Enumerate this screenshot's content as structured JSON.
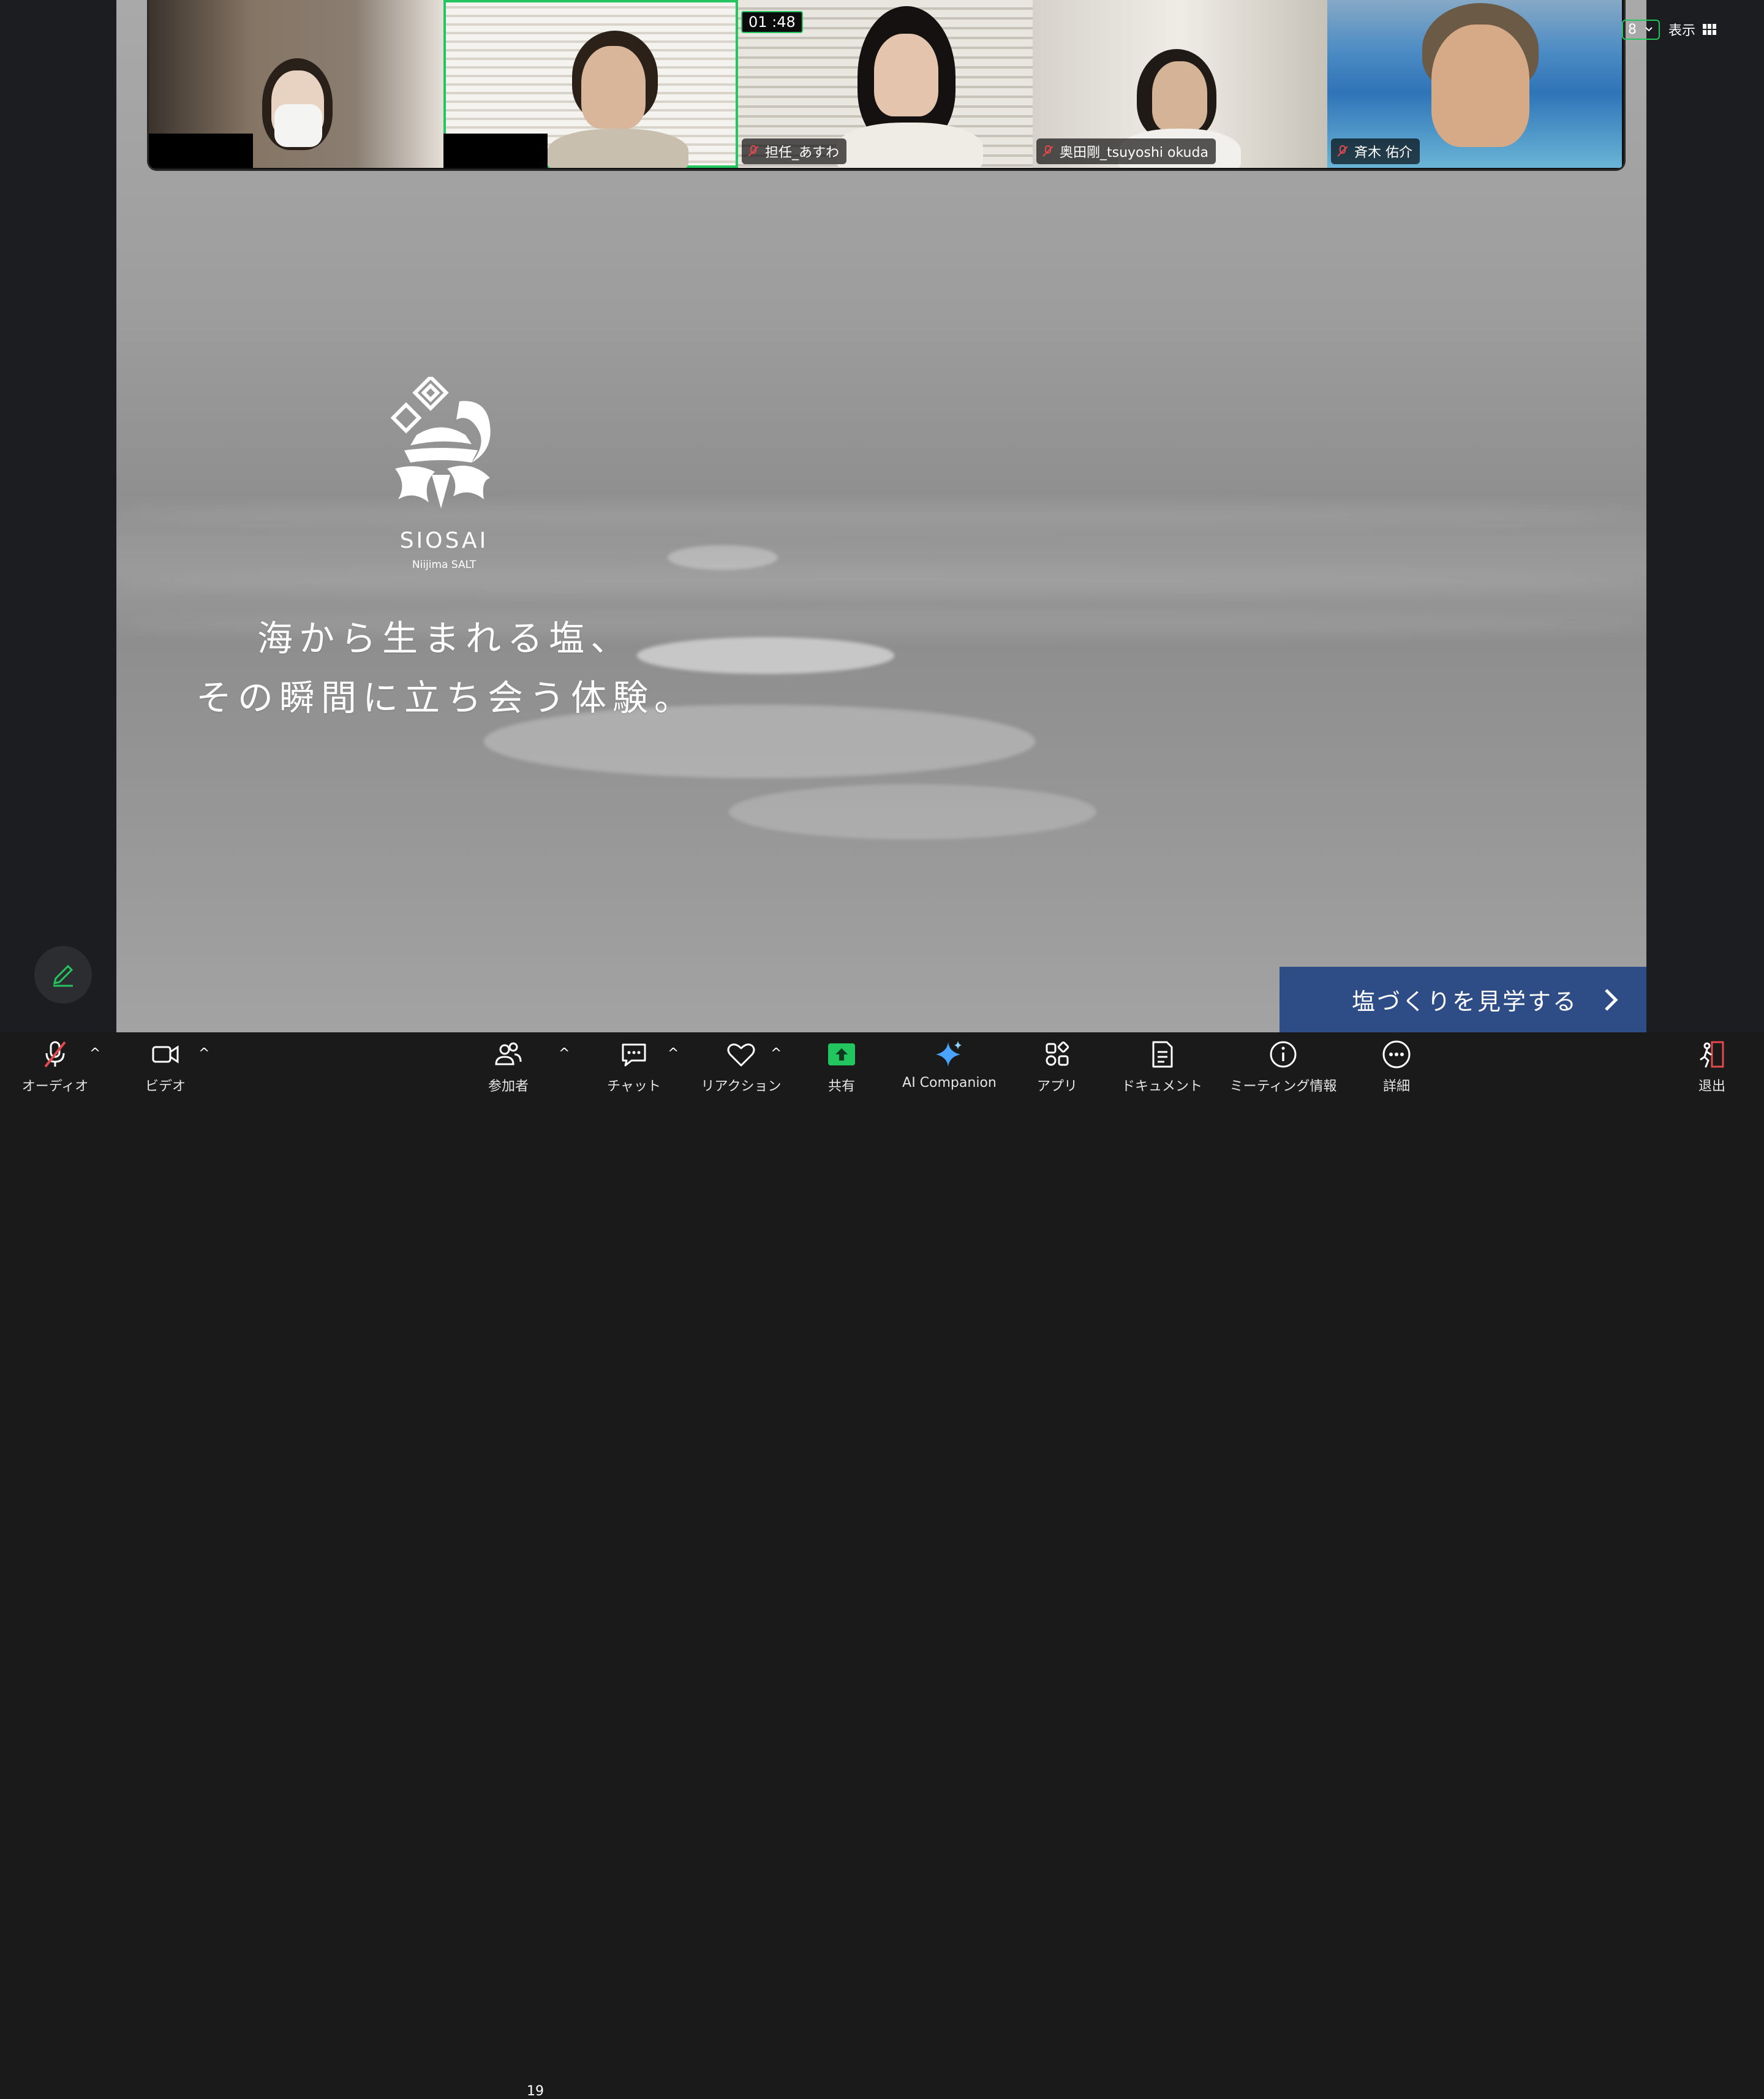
{
  "gallery": {
    "participants": [
      {
        "name": "",
        "muted": false
      },
      {
        "name": "",
        "muted": false,
        "active_speaker": true
      },
      {
        "name": "担任_あすわ",
        "muted": true
      },
      {
        "name": "奥田剛_tsuyoshi okuda",
        "muted": true
      },
      {
        "name": "斉木 佑介",
        "muted": true
      }
    ],
    "timer": "01 :48"
  },
  "view_controls": {
    "count": "8",
    "view_label": "表示"
  },
  "shared_screen": {
    "brand": "SIOSAI",
    "brand_sub": "Niijima SALT",
    "headline_line1": "海から生まれる塩、",
    "headline_line2": "その瞬間に立ち会う体験。",
    "tour_button": "塩づくりを見学する"
  },
  "toolbar": {
    "audio": "オーディオ",
    "video": "ビデオ",
    "participants": "参加者",
    "participant_count": "19",
    "chat": "チャット",
    "reactions": "リアクション",
    "share": "共有",
    "ai_companion": "AI Companion",
    "apps": "アプリ",
    "documents": "ドキュメント",
    "meeting_info": "ミーティング情報",
    "more": "詳細",
    "leave": "退出"
  },
  "colors": {
    "accent_green": "#22c55e",
    "leave_red": "#e5484d",
    "tour_blue": "#2e4d86"
  }
}
